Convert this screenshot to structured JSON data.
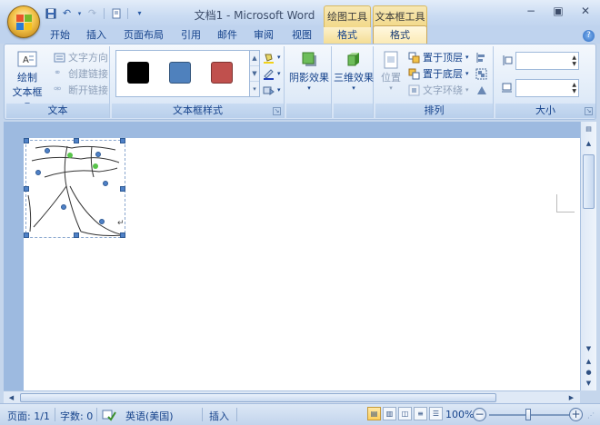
{
  "window": {
    "title": "文档1 - Microsoft Word",
    "context_group_drawing": "绘图工具",
    "context_group_textbox": "文本框工具"
  },
  "tabs": [
    "开始",
    "插入",
    "页面布局",
    "引用",
    "邮件",
    "审阅",
    "视图",
    "格式",
    "格式"
  ],
  "ribbon": {
    "text_group": {
      "label": "文本",
      "draw_textbox": "绘制",
      "draw_textbox_line2": "文本框",
      "text_direction": "文字方向",
      "create_link": "创建链接",
      "break_link": "断开链接"
    },
    "style_group": {
      "label": "文本框样式",
      "swatches": [
        "#000000",
        "#4f81bd",
        "#c0504d"
      ]
    },
    "shadow": "阴影效果",
    "threed": "三维效果",
    "arrange_group": {
      "label": "排列",
      "position": "位置",
      "bring_front": "置于顶层",
      "send_back": "置于底层",
      "text_wrap": "文字环绕"
    },
    "size_group": {
      "label": "大小"
    }
  },
  "statusbar": {
    "page": "页面: 1/1",
    "words": "字数: 0",
    "language": "英语(美国)",
    "mode": "插入",
    "zoom": "100%"
  },
  "colors": {
    "accent": "#15428b",
    "ribbon_bg": "#dbe6f5",
    "contextual": "#f4dd94"
  }
}
